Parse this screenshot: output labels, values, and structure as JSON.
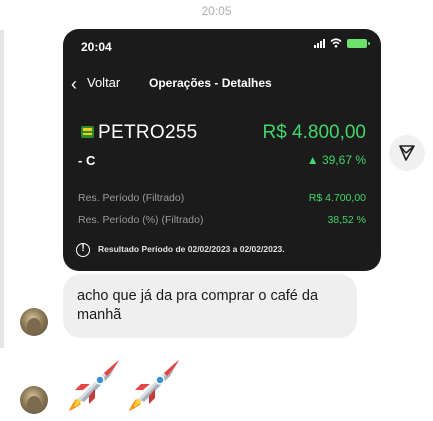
{
  "chat": {
    "timestamp": "20:05"
  },
  "shared_screenshot": {
    "status_time": "20:04",
    "nav": {
      "back_label": "Voltar",
      "title": "Operações - Detalhes"
    },
    "stock": {
      "ticker": "PETRO255",
      "price": "R$ 4.800,00",
      "suffix": "- C",
      "change_pct": "▲ 39,67 %"
    },
    "results": [
      {
        "label": "Res. Período (Filtrado)",
        "value": "R$ 4.700,00"
      },
      {
        "label": "Res. Período (%) (Filtrado)",
        "value": "38,52 %"
      }
    ],
    "notice": "Resultado Período de 02/02/2023 a 02/02/2023.",
    "colors": {
      "positive": "#41d66b",
      "background": "#1b1b1b"
    }
  },
  "message": {
    "text_line1": "acho que já da pra comprar o café da",
    "text_line2": "manhã"
  },
  "emojis": [
    "rocket-icon",
    "rocket-icon"
  ]
}
